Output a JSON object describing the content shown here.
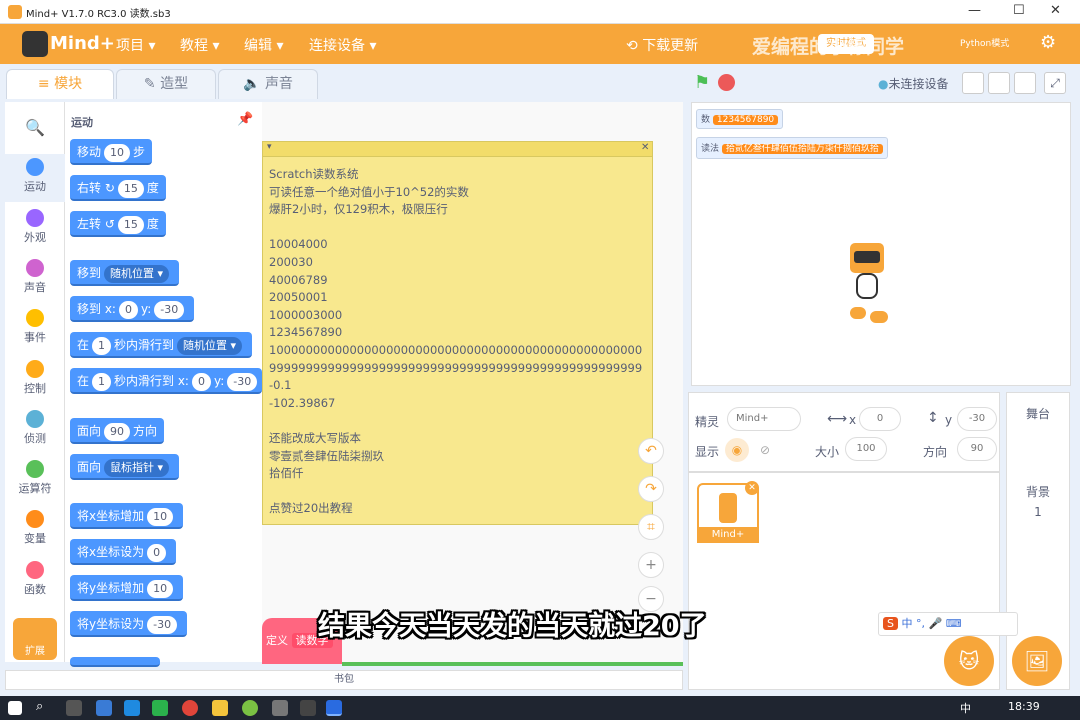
{
  "window": {
    "title": "Mind+ V1.7.0 RC3.0   读数.sb3"
  },
  "menubar": {
    "logo": "Mind+",
    "items": [
      "项目",
      "教程",
      "编辑",
      "连接设备"
    ],
    "download": "下载更新",
    "watermark": "爱编程的小栋同学",
    "realtime": "实时模式",
    "mode_python": "Python模式"
  },
  "tabs": [
    "模块",
    "造型",
    "声音"
  ],
  "categories": [
    {
      "label": "运动",
      "color": "#4c97ff"
    },
    {
      "label": "外观",
      "color": "#9966ff"
    },
    {
      "label": "声音",
      "color": "#cf63cf"
    },
    {
      "label": "事件",
      "color": "#ffbf00"
    },
    {
      "label": "控制",
      "color": "#ffab19"
    },
    {
      "label": "侦测",
      "color": "#5cb1d6"
    },
    {
      "label": "运算符",
      "color": "#59c059"
    },
    {
      "label": "变量",
      "color": "#ff8c1a"
    },
    {
      "label": "函数",
      "color": "#ff6680"
    }
  ],
  "extensions_label": "扩展",
  "palette": {
    "section": "运动",
    "move": {
      "a": "移动",
      "v": "10",
      "b": "步"
    },
    "turn_right": {
      "a": "右转",
      "v": "15",
      "b": "度"
    },
    "turn_left": {
      "a": "左转",
      "v": "15",
      "b": "度"
    },
    "goto": {
      "a": "移到",
      "dd": "随机位置"
    },
    "goto_xy": {
      "a": "移到 x:",
      "x": "0",
      "b": "y:",
      "y": "-30"
    },
    "glide": {
      "a": "在",
      "v": "1",
      "b": "秒内滑行到",
      "dd": "随机位置"
    },
    "glide_xy": {
      "a": "在",
      "v": "1",
      "b": "秒内滑行到 x:",
      "x": "0",
      "c": "y:",
      "y": "-30"
    },
    "point": {
      "a": "面向",
      "v": "90",
      "b": "方向"
    },
    "point_towards": {
      "a": "面向",
      "dd": "鼠标指针"
    },
    "change_x": {
      "a": "将x坐标增加",
      "v": "10"
    },
    "set_x": {
      "a": "将x坐标设为",
      "v": "0"
    },
    "change_y": {
      "a": "将y坐标增加",
      "v": "10"
    },
    "set_y": {
      "a": "将y坐标设为",
      "v": "-30"
    }
  },
  "note": {
    "lines": [
      "Scratch读数系统",
      "可读任意一个绝对值小于10^52的实数",
      "爆肝2小时，仅129积木，极限压行",
      "",
      "10004000",
      "200030",
      "40006789",
      "20050001",
      "1000003000",
      "1234567890",
      "100000000000000000000000000000000000000000000000000",
      "999999999999999999999999999999999999999999999999999",
      "-0.1",
      "-102.39867",
      "",
      "还能改成大写版本",
      "零壹贰叁肆伍陆柒捌玖",
      "拾佰仟",
      "",
      "点赞过20出教程"
    ]
  },
  "define_block": {
    "a": "定义",
    "b": "读数字"
  },
  "stage": {
    "status": "未连接设备",
    "monitors": [
      {
        "label": "数",
        "value": "1234567890"
      },
      {
        "label": "读法",
        "value": "拾贰亿叁仟肆佰伍拾陆万柒仟捌佰玖拾"
      }
    ]
  },
  "sprite": {
    "label": "精灵",
    "name": "Mind+",
    "x_label": "x",
    "x": "0",
    "y_label": "y",
    "y": "-30",
    "show_label": "显示",
    "size_label": "大小",
    "size": "100",
    "dir_label": "方向",
    "dir": "90",
    "thumb_label": "Mind+"
  },
  "stage_pane": {
    "title": "舞台",
    "backdrop_label": "背景",
    "backdrop_count": "1"
  },
  "backpack": "书包",
  "subtitle": "结果今天当天发的当天就过20了",
  "taskbar": {
    "ime": "中",
    "time": "18:39"
  },
  "ime_bar": [
    "中",
    "°,",
    "🎤",
    "⌨"
  ]
}
